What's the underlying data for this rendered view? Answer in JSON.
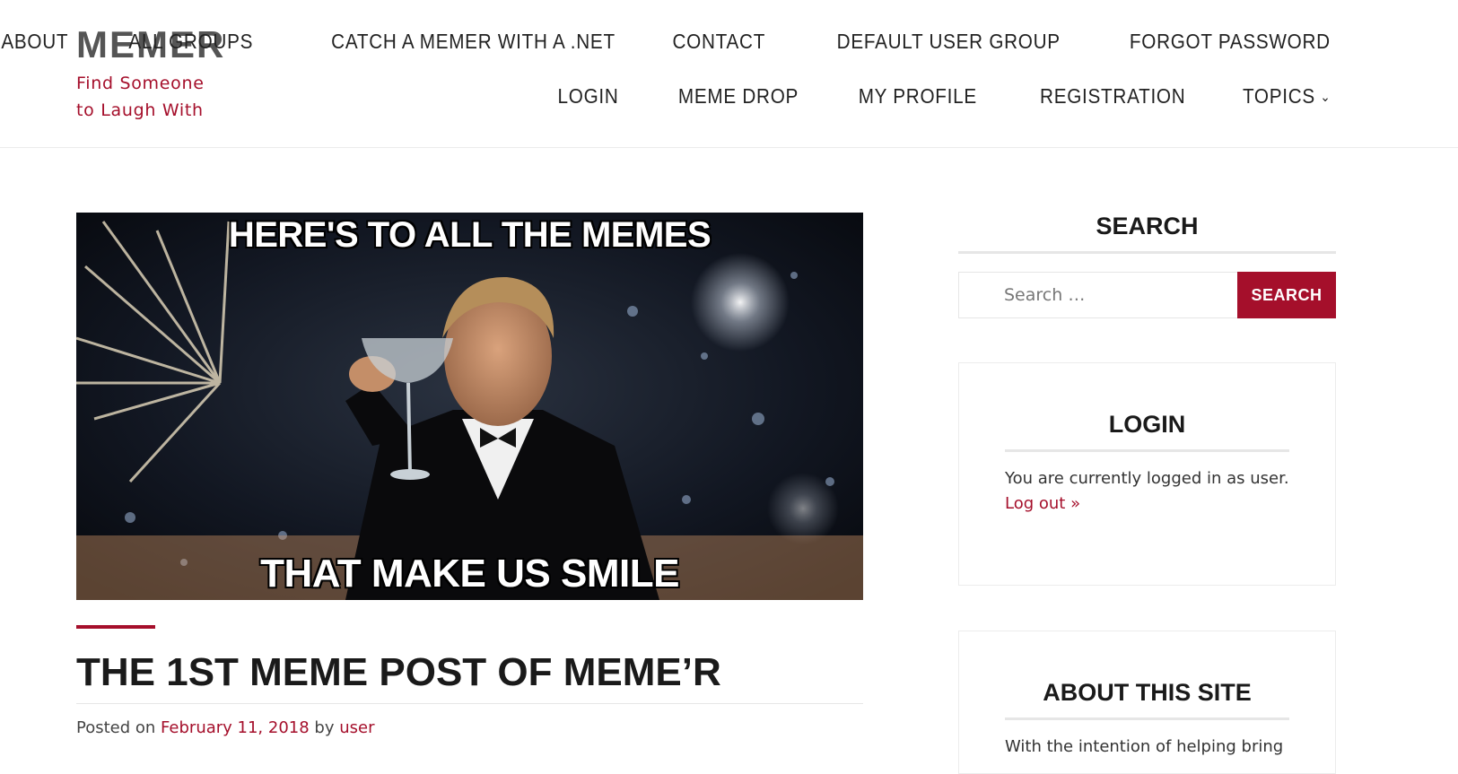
{
  "site": {
    "title": "MEMER",
    "description": "Find Someone to Laugh With"
  },
  "nav": {
    "row1": [
      "ABOUT",
      "ALL GROUPS",
      "CATCH A MEMER WITH A .NET",
      "CONTACT",
      "DEFAULT USER GROUP",
      "FORGOT PASSWORD"
    ],
    "row2": [
      "LOGIN",
      "MEME DROP",
      "MY PROFILE",
      "REGISTRATION",
      "TOPICS"
    ],
    "topics_icon": "chevron-down-icon"
  },
  "post": {
    "image_top_text": "HERE'S TO ALL THE MEMES",
    "image_bottom_text": "THAT MAKE US SMILE",
    "title": "THE 1ST MEME POST OF MEME’R",
    "meta_prefix": "Posted on",
    "date": "February 11, 2018",
    "meta_by": "by",
    "author": "user"
  },
  "sidebar": {
    "search": {
      "title": "SEARCH",
      "placeholder": "Search …",
      "button_label": "SEARCH"
    },
    "login": {
      "title": "LOGIN",
      "text": "You are currently logged in as user.",
      "logout_label": "Log out »"
    },
    "about": {
      "title": "ABOUT THIS SITE",
      "text": "With the intention of helping bring"
    }
  },
  "colors": {
    "accent": "#a50f2b",
    "heading": "#1a1a1a",
    "nav_text": "#222222"
  }
}
